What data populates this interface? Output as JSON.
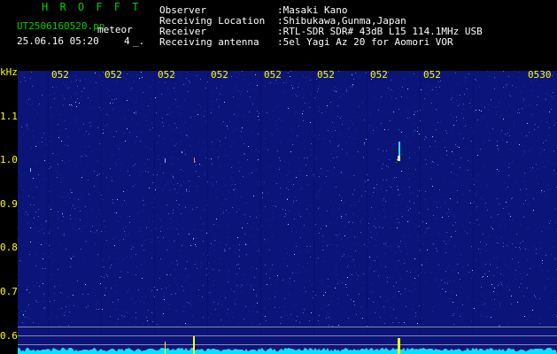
{
  "header": {
    "program": "H R O F F T",
    "filename": "UT2506160520.pn",
    "mode": "meteor",
    "datetime": "25.06.16 05:20",
    "count": "4",
    "marker": "_.",
    "fields": [
      {
        "label": "Observer",
        "value": ":Masaki Kano"
      },
      {
        "label": "Receiving Location",
        "value": ":Shibukawa,Gunma,Japan"
      },
      {
        "label": "Receiver",
        "value": ":RTL-SDR SDR# 43dB L15 114.1MHz USB"
      },
      {
        "label": "Receiving antenna",
        "value": ":5el Yagi Az 20 for Aomori VOR"
      }
    ]
  },
  "axis": {
    "unit": "kHz",
    "y_ticks": [
      "1.1",
      "1.0",
      "0.9",
      "0.8",
      "0.7",
      "0.6"
    ],
    "x_ticks": [
      "052",
      "052",
      "052",
      "052",
      "052",
      "052",
      "052",
      "052",
      "0530"
    ]
  },
  "colors": {
    "background": "#0b1478",
    "noise": "#4aa8ff",
    "text_header": "#ffffff",
    "text_title": "#00d000",
    "text_axis": "#ffff00",
    "trace": "#00e5ff"
  }
}
